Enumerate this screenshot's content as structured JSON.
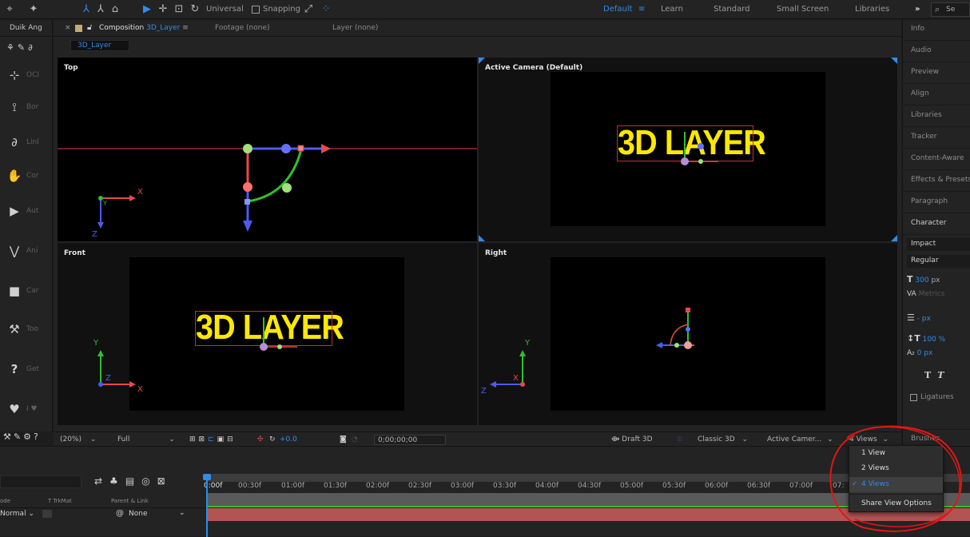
{
  "workspace_toolbar": {
    "universal_label": "Universal",
    "snapping_label": "Snapping",
    "workspaces": [
      {
        "label": "Default",
        "active": true
      },
      {
        "label": "Learn",
        "active": false
      },
      {
        "label": "Standard",
        "active": false
      },
      {
        "label": "Small Screen",
        "active": false
      },
      {
        "label": "Libraries",
        "active": false
      }
    ],
    "overflow_label": "»",
    "search_partial": "Se"
  },
  "left_panel": {
    "title": "Duik Ang",
    "items": [
      {
        "icon": "bone-cursor-icon",
        "label": "OCI"
      },
      {
        "icon": "bone-icon",
        "label": "Bor"
      },
      {
        "icon": "link-icon",
        "label": "Linl"
      },
      {
        "icon": "hand-icon",
        "label": "Cor"
      },
      {
        "icon": "play-icon",
        "label": "Aut"
      },
      {
        "icon": "animation-icon",
        "label": "Ani"
      },
      {
        "icon": "camera-icon",
        "label": "Car"
      },
      {
        "icon": "tools-icon",
        "label": "Too"
      },
      {
        "icon": "help-icon",
        "label": "Get"
      },
      {
        "icon": "heart-icon",
        "label": "I ♥"
      }
    ]
  },
  "comp_panel": {
    "tab_prefix": "Composition",
    "comp_name": "3D_Layer",
    "footage_label": "Footage (none)",
    "layer_label": "Layer (none)",
    "breadcrumb": "3D_Layer",
    "views": {
      "top": "Top",
      "active_camera": "Active Camera (Default)",
      "front": "Front",
      "right": "Right"
    },
    "layer_text": "3D LAYER",
    "axes": {
      "x": "X",
      "y": "Y",
      "z": "Z"
    }
  },
  "comp_bottom_bar": {
    "zoom": "(20%)",
    "resolution": "Full",
    "exposure": "+0.0",
    "timecode": "0;00;00;00",
    "draft3d": "Draft 3D",
    "renderer": "Classic 3D",
    "camera": "Active Camer...",
    "views_select": "4 Views"
  },
  "right_panel": {
    "items": [
      "Info",
      "Audio",
      "Preview",
      "Align",
      "Libraries",
      "Tracker",
      "Content-Aware",
      "Effects & Presets",
      "Paragraph",
      "Character"
    ],
    "font_family": "Impact",
    "font_style": "Regular",
    "font_size": "300",
    "font_size_unit": "px",
    "kerning": "Metrics",
    "leading": "- px",
    "vertical_scale": "100 %",
    "baseline": "0 px",
    "ligatures_label": "Ligatures",
    "brushes_label": "Brushes"
  },
  "timeline": {
    "col_mode": "ode",
    "col_trkmat": "T  TrkMat",
    "col_parent": "Parent & Link",
    "mode_value": "Normal",
    "parent_value": "None",
    "time_labels": [
      "0:00f",
      "00:30f",
      "01:00f",
      "01:30f",
      "02:00f",
      "02:30f",
      "03:00f",
      "03:30f",
      "04:00f",
      "04:30f",
      "05:00f",
      "05:30f",
      "06:00f",
      "06:30f",
      "07:00f",
      "07:"
    ]
  },
  "views_dropdown": {
    "options": [
      {
        "label": "1 View",
        "selected": false
      },
      {
        "label": "2 Views",
        "selected": false
      },
      {
        "label": "4 Views",
        "selected": true
      }
    ],
    "share_label": "Share View Options"
  },
  "colors": {
    "accent": "#2d8ceb",
    "layer_text": "#ffe800",
    "axis_x": "#e8494b",
    "axis_y": "#2fc12c",
    "axis_z": "#4d5bef",
    "annotation": "#e01616"
  }
}
